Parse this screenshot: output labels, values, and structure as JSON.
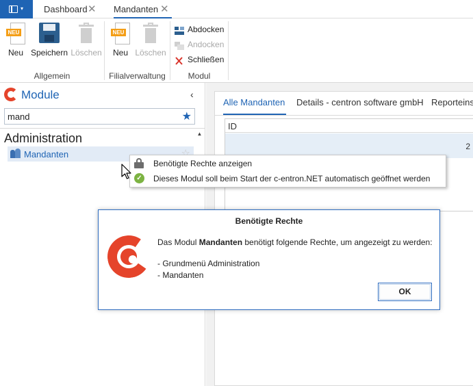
{
  "tabs": [
    {
      "label": "Dashboard",
      "close": "✕"
    },
    {
      "label": "Mandanten",
      "close": "✕"
    }
  ],
  "ribbon": {
    "groups": {
      "allgemein": "Allgemein",
      "filialverwaltung": "Filialverwaltung",
      "modul": "Modul"
    },
    "neu_badge": "NEU",
    "buttons": {
      "neu": "Neu",
      "speichern": "Speichern",
      "loeschen": "Löschen",
      "neu2": "Neu",
      "loeschen2": "Löschen",
      "abdocken": "Abdocken",
      "andocken": "Andocken",
      "schliessen": "Schließen"
    }
  },
  "left_panel": {
    "title": "Module",
    "search_value": "mand",
    "section": "Administration",
    "item": "Mandanten"
  },
  "content": {
    "tabs": [
      "Alle Mandanten",
      "Details - centron software gmbH",
      "Reporteinste"
    ],
    "grid": {
      "header": "ID",
      "rows": [
        "2"
      ]
    }
  },
  "context_menu": {
    "items": [
      "Benötigte Rechte anzeigen",
      "Dieses Modul soll beim Start der c-entron.NET automatisch geöffnet werden"
    ]
  },
  "dialog": {
    "title": "Benötigte Rechte",
    "msg_before": "Das Modul ",
    "msg_bold": "Mandanten",
    "msg_after": " benötigt folgende Rechte, um angezeigt zu werden:",
    "requirements": [
      "- Grundmenü Administration",
      "- Mandanten"
    ],
    "ok": "OK"
  },
  "colors": {
    "accent": "#1f64b4",
    "brand": "#e5442b",
    "ribbon_badge": "#f49e16"
  }
}
